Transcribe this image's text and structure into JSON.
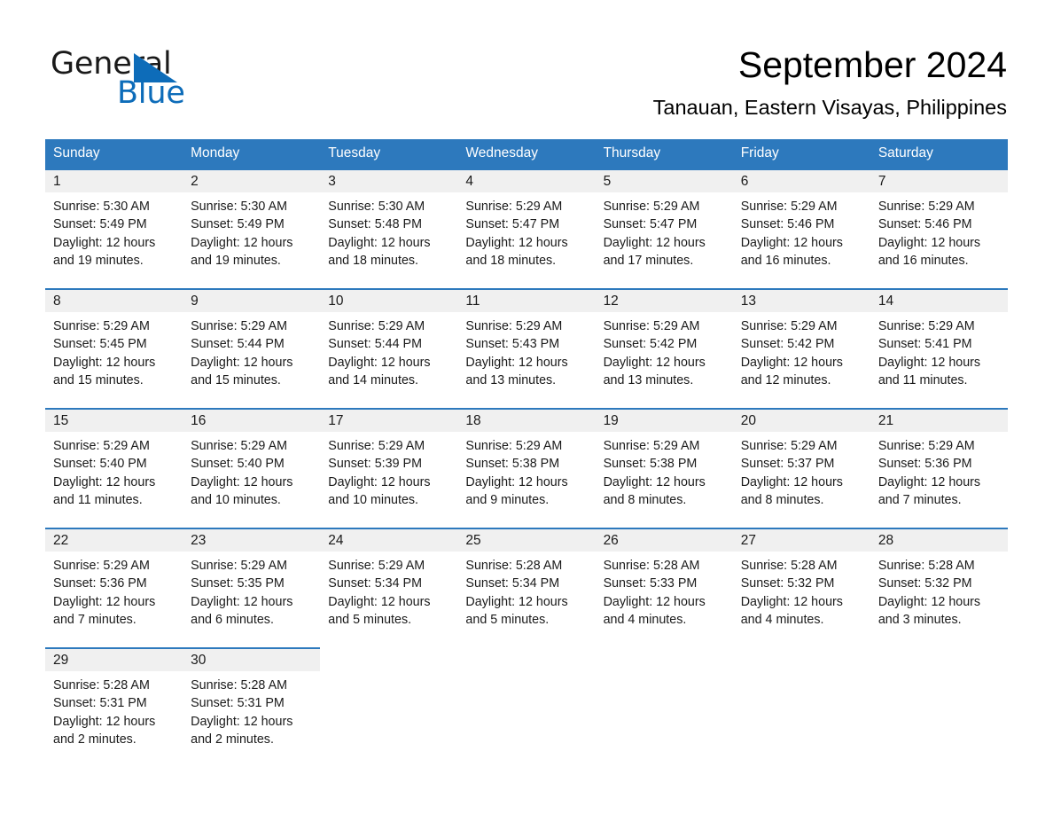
{
  "brand": {
    "name_part1": "General",
    "name_part2": "Blue",
    "accent_color": "#0d6cb9",
    "triangle_icon": "triangle-icon"
  },
  "header": {
    "title": "September 2024",
    "subtitle": "Tanauan, Eastern Visayas, Philippines"
  },
  "colors": {
    "header_blue": "#2d79bd",
    "daynum_band": "#f0f0f0",
    "text": "#1a1a1a"
  },
  "weekday_headers": [
    "Sunday",
    "Monday",
    "Tuesday",
    "Wednesday",
    "Thursday",
    "Friday",
    "Saturday"
  ],
  "weeks": [
    [
      {
        "day": "1",
        "sunrise": "Sunrise: 5:30 AM",
        "sunset": "Sunset: 5:49 PM",
        "daylight": "Daylight: 12 hours and 19 minutes."
      },
      {
        "day": "2",
        "sunrise": "Sunrise: 5:30 AM",
        "sunset": "Sunset: 5:49 PM",
        "daylight": "Daylight: 12 hours and 19 minutes."
      },
      {
        "day": "3",
        "sunrise": "Sunrise: 5:30 AM",
        "sunset": "Sunset: 5:48 PM",
        "daylight": "Daylight: 12 hours and 18 minutes."
      },
      {
        "day": "4",
        "sunrise": "Sunrise: 5:29 AM",
        "sunset": "Sunset: 5:47 PM",
        "daylight": "Daylight: 12 hours and 18 minutes."
      },
      {
        "day": "5",
        "sunrise": "Sunrise: 5:29 AM",
        "sunset": "Sunset: 5:47 PM",
        "daylight": "Daylight: 12 hours and 17 minutes."
      },
      {
        "day": "6",
        "sunrise": "Sunrise: 5:29 AM",
        "sunset": "Sunset: 5:46 PM",
        "daylight": "Daylight: 12 hours and 16 minutes."
      },
      {
        "day": "7",
        "sunrise": "Sunrise: 5:29 AM",
        "sunset": "Sunset: 5:46 PM",
        "daylight": "Daylight: 12 hours and 16 minutes."
      }
    ],
    [
      {
        "day": "8",
        "sunrise": "Sunrise: 5:29 AM",
        "sunset": "Sunset: 5:45 PM",
        "daylight": "Daylight: 12 hours and 15 minutes."
      },
      {
        "day": "9",
        "sunrise": "Sunrise: 5:29 AM",
        "sunset": "Sunset: 5:44 PM",
        "daylight": "Daylight: 12 hours and 15 minutes."
      },
      {
        "day": "10",
        "sunrise": "Sunrise: 5:29 AM",
        "sunset": "Sunset: 5:44 PM",
        "daylight": "Daylight: 12 hours and 14 minutes."
      },
      {
        "day": "11",
        "sunrise": "Sunrise: 5:29 AM",
        "sunset": "Sunset: 5:43 PM",
        "daylight": "Daylight: 12 hours and 13 minutes."
      },
      {
        "day": "12",
        "sunrise": "Sunrise: 5:29 AM",
        "sunset": "Sunset: 5:42 PM",
        "daylight": "Daylight: 12 hours and 13 minutes."
      },
      {
        "day": "13",
        "sunrise": "Sunrise: 5:29 AM",
        "sunset": "Sunset: 5:42 PM",
        "daylight": "Daylight: 12 hours and 12 minutes."
      },
      {
        "day": "14",
        "sunrise": "Sunrise: 5:29 AM",
        "sunset": "Sunset: 5:41 PM",
        "daylight": "Daylight: 12 hours and 11 minutes."
      }
    ],
    [
      {
        "day": "15",
        "sunrise": "Sunrise: 5:29 AM",
        "sunset": "Sunset: 5:40 PM",
        "daylight": "Daylight: 12 hours and 11 minutes."
      },
      {
        "day": "16",
        "sunrise": "Sunrise: 5:29 AM",
        "sunset": "Sunset: 5:40 PM",
        "daylight": "Daylight: 12 hours and 10 minutes."
      },
      {
        "day": "17",
        "sunrise": "Sunrise: 5:29 AM",
        "sunset": "Sunset: 5:39 PM",
        "daylight": "Daylight: 12 hours and 10 minutes."
      },
      {
        "day": "18",
        "sunrise": "Sunrise: 5:29 AM",
        "sunset": "Sunset: 5:38 PM",
        "daylight": "Daylight: 12 hours and 9 minutes."
      },
      {
        "day": "19",
        "sunrise": "Sunrise: 5:29 AM",
        "sunset": "Sunset: 5:38 PM",
        "daylight": "Daylight: 12 hours and 8 minutes."
      },
      {
        "day": "20",
        "sunrise": "Sunrise: 5:29 AM",
        "sunset": "Sunset: 5:37 PM",
        "daylight": "Daylight: 12 hours and 8 minutes."
      },
      {
        "day": "21",
        "sunrise": "Sunrise: 5:29 AM",
        "sunset": "Sunset: 5:36 PM",
        "daylight": "Daylight: 12 hours and 7 minutes."
      }
    ],
    [
      {
        "day": "22",
        "sunrise": "Sunrise: 5:29 AM",
        "sunset": "Sunset: 5:36 PM",
        "daylight": "Daylight: 12 hours and 7 minutes."
      },
      {
        "day": "23",
        "sunrise": "Sunrise: 5:29 AM",
        "sunset": "Sunset: 5:35 PM",
        "daylight": "Daylight: 12 hours and 6 minutes."
      },
      {
        "day": "24",
        "sunrise": "Sunrise: 5:29 AM",
        "sunset": "Sunset: 5:34 PM",
        "daylight": "Daylight: 12 hours and 5 minutes."
      },
      {
        "day": "25",
        "sunrise": "Sunrise: 5:28 AM",
        "sunset": "Sunset: 5:34 PM",
        "daylight": "Daylight: 12 hours and 5 minutes."
      },
      {
        "day": "26",
        "sunrise": "Sunrise: 5:28 AM",
        "sunset": "Sunset: 5:33 PM",
        "daylight": "Daylight: 12 hours and 4 minutes."
      },
      {
        "day": "27",
        "sunrise": "Sunrise: 5:28 AM",
        "sunset": "Sunset: 5:32 PM",
        "daylight": "Daylight: 12 hours and 4 minutes."
      },
      {
        "day": "28",
        "sunrise": "Sunrise: 5:28 AM",
        "sunset": "Sunset: 5:32 PM",
        "daylight": "Daylight: 12 hours and 3 minutes."
      }
    ],
    [
      {
        "day": "29",
        "sunrise": "Sunrise: 5:28 AM",
        "sunset": "Sunset: 5:31 PM",
        "daylight": "Daylight: 12 hours and 2 minutes."
      },
      {
        "day": "30",
        "sunrise": "Sunrise: 5:28 AM",
        "sunset": "Sunset: 5:31 PM",
        "daylight": "Daylight: 12 hours and 2 minutes."
      },
      null,
      null,
      null,
      null,
      null
    ]
  ]
}
